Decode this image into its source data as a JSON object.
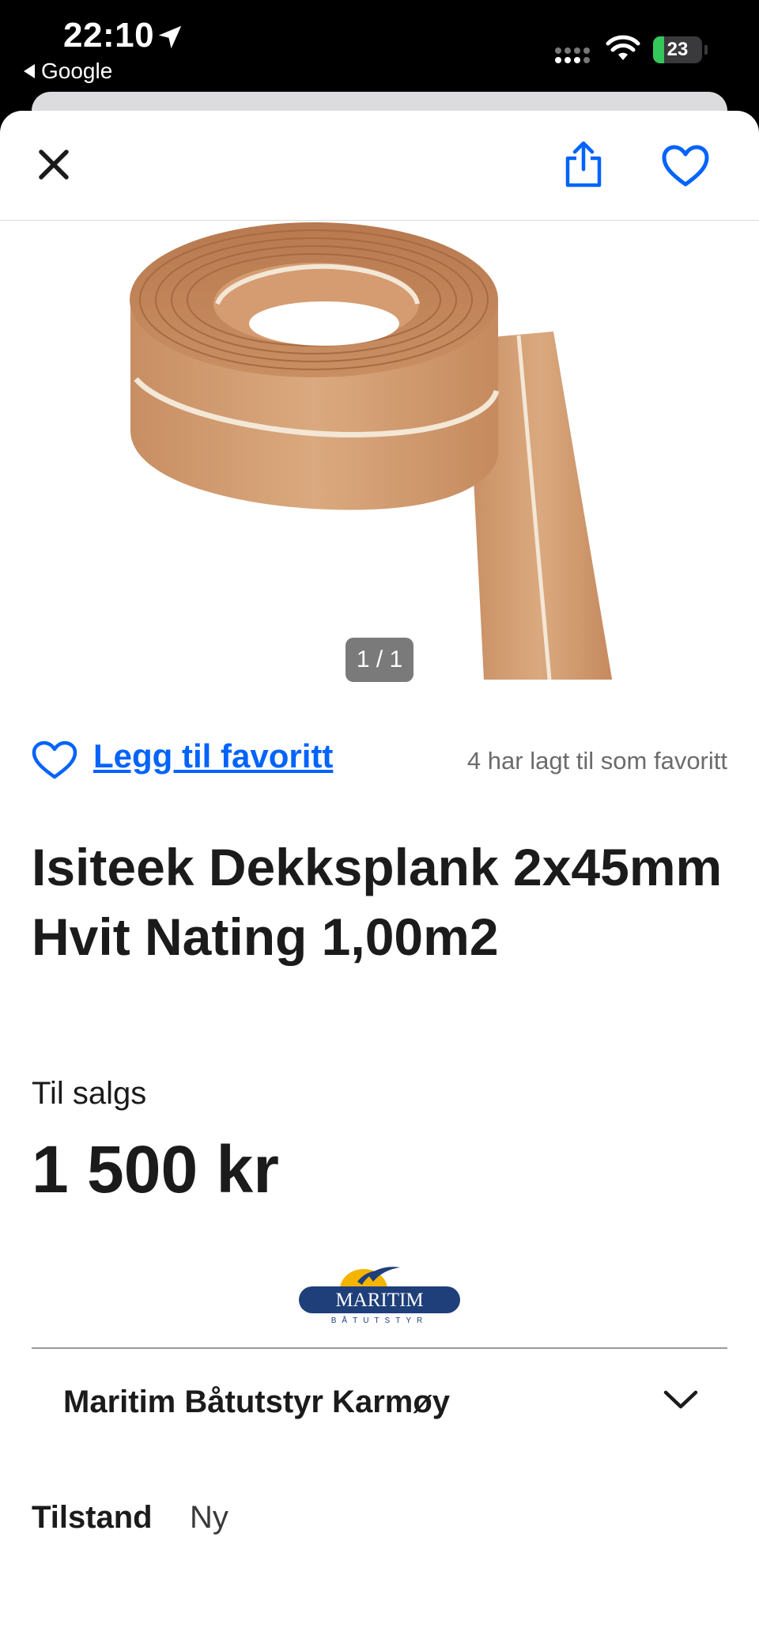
{
  "status_bar": {
    "time": "22:10",
    "back_app": "Google",
    "battery": "23",
    "battery_level": 0.23
  },
  "nav": {
    "close_icon": "close-icon",
    "share_icon": "share-icon",
    "favorite_icon": "heart-outline-icon"
  },
  "gallery": {
    "counter": "1 / 1"
  },
  "favorite": {
    "link_label": "Legg til favoritt",
    "count_text": "4 har lagt til som favoritt"
  },
  "listing": {
    "title": "Isiteek Dekksplank 2x45mm Hvit Nating 1,00m2",
    "status": "Til salgs",
    "price": "1 500 kr"
  },
  "seller": {
    "logo_text": "MARITIM",
    "logo_subtext": "BÅTUTSTYR",
    "name": "Maritim Båtutstyr Karmøy"
  },
  "details": {
    "condition_label": "Tilstand",
    "condition_value": "Ny"
  },
  "colors": {
    "accent": "#0063fb",
    "text": "#1b1b1b"
  }
}
